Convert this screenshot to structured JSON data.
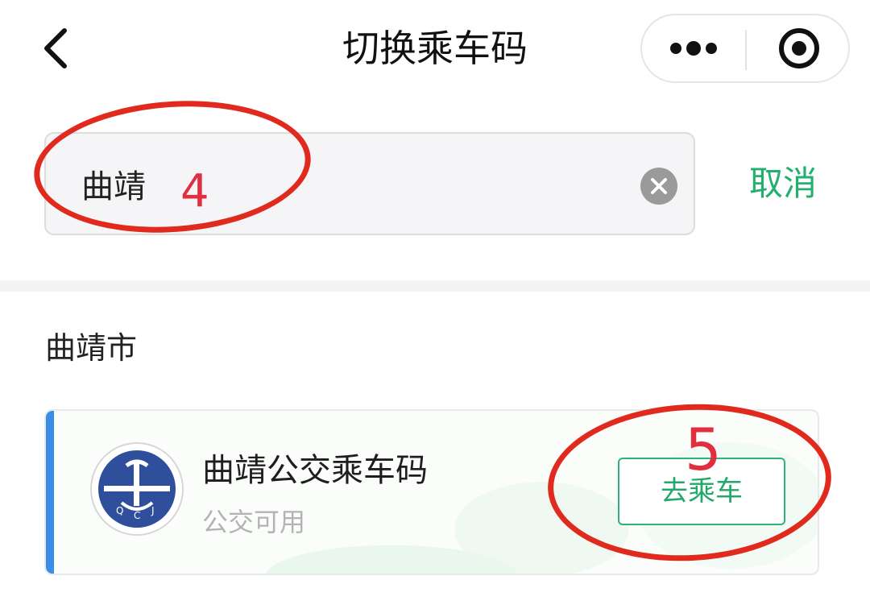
{
  "nav": {
    "title": "切换乘车码",
    "back_icon": "chevron-left-icon",
    "more_icon": "more-dots-icon",
    "close_icon": "target-circle-icon"
  },
  "search": {
    "value": "曲靖",
    "clear_icon": "clear-circle-icon",
    "cancel_label": "取消"
  },
  "annotations": {
    "label_4": "4",
    "label_5": "5",
    "color": "#e02a1e"
  },
  "results": {
    "city": "曲靖市",
    "items": [
      {
        "name": "曲靖公交乘车码",
        "subtitle": "公交可用",
        "action_label": "去乘车",
        "logo_letters": "QCJ"
      }
    ]
  },
  "colors": {
    "accent_green": "#21b06d",
    "card_accent_blue": "#3a8ee8",
    "logo_blue": "#2f4f9c"
  }
}
